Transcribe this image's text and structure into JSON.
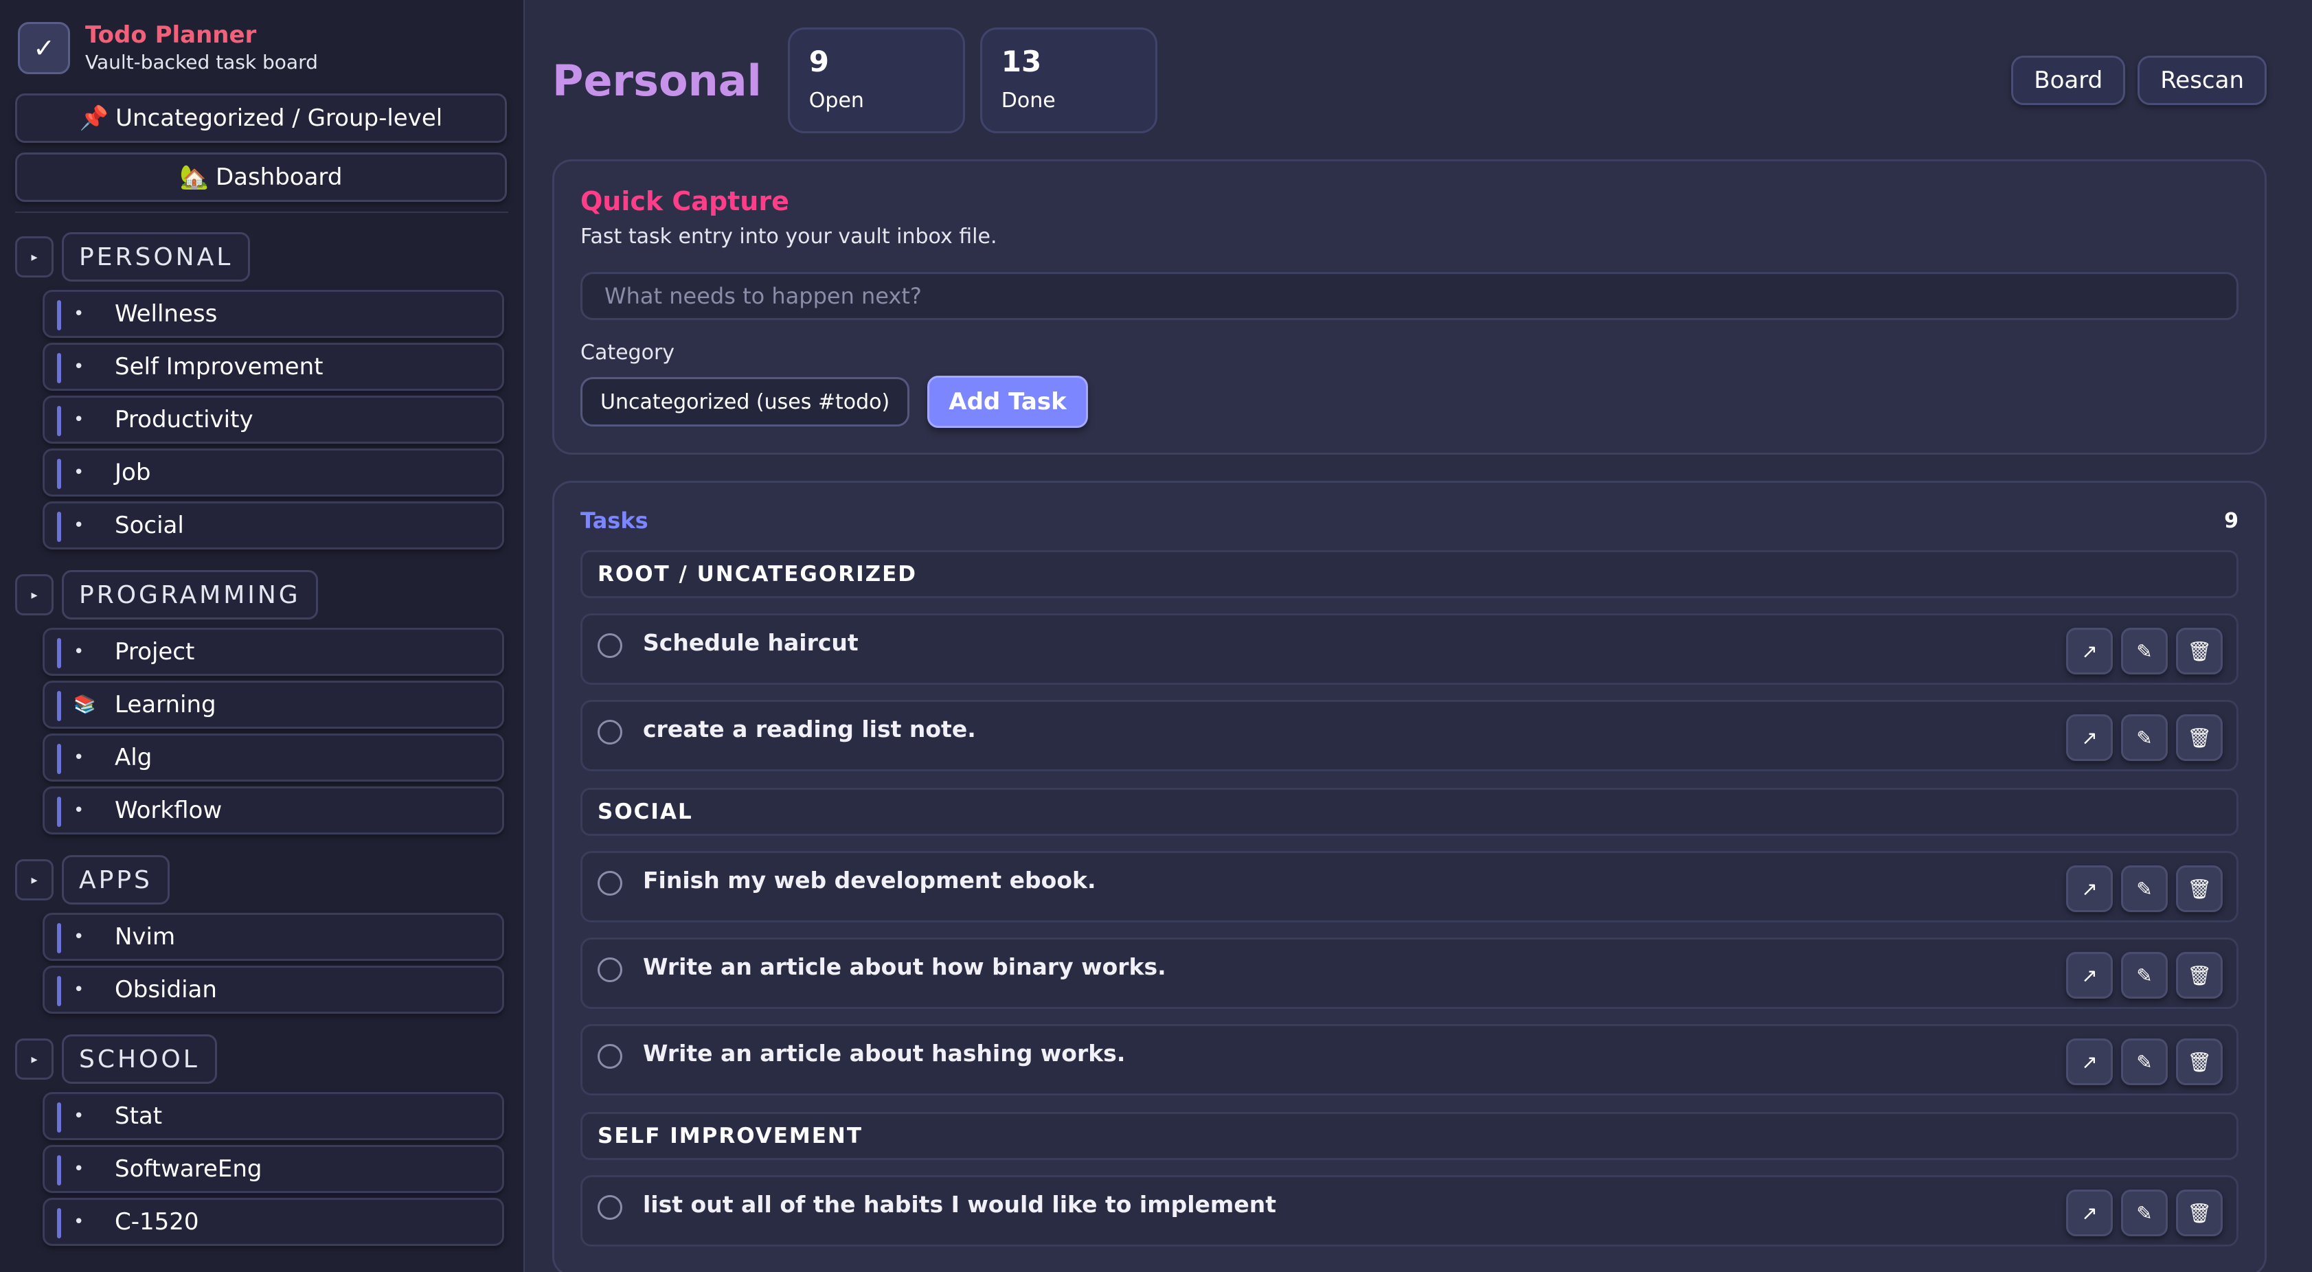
{
  "brand": {
    "title": "Todo Planner",
    "subtitle": "Vault-backed task board",
    "check_icon": "✓"
  },
  "sidebar": {
    "top_buttons": [
      {
        "icon": "📌",
        "label": "Uncategorized / Group-level"
      },
      {
        "icon": "🏡",
        "label": "Dashboard"
      }
    ],
    "groups": [
      {
        "label": "PERSONAL",
        "items": [
          {
            "icon": "•",
            "label": "Wellness"
          },
          {
            "icon": "•",
            "label": "Self Improvement"
          },
          {
            "icon": "•",
            "label": "Productivity"
          },
          {
            "icon": "•",
            "label": "Job"
          },
          {
            "icon": "•",
            "label": "Social"
          }
        ]
      },
      {
        "label": "PROGRAMMING",
        "items": [
          {
            "icon": "•",
            "label": "Project"
          },
          {
            "icon": "📚",
            "label": "Learning"
          },
          {
            "icon": "•",
            "label": "Alg"
          },
          {
            "icon": "•",
            "label": "Workflow"
          }
        ]
      },
      {
        "label": "APPS",
        "items": [
          {
            "icon": "•",
            "label": "Nvim"
          },
          {
            "icon": "•",
            "label": "Obsidian"
          }
        ]
      },
      {
        "label": "SCHOOL",
        "items": [
          {
            "icon": "•",
            "label": "Stat"
          },
          {
            "icon": "•",
            "label": "SoftwareEng"
          },
          {
            "icon": "•",
            "label": "C-1520"
          }
        ]
      }
    ]
  },
  "header": {
    "title": "Personal",
    "stats": {
      "open_value": "9",
      "open_label": "Open",
      "done_value": "13",
      "done_label": "Done"
    },
    "board_label": "Board",
    "rescan_label": "Rescan"
  },
  "quick_capture": {
    "title": "Quick Capture",
    "subtitle": "Fast task entry into your vault inbox file.",
    "input_placeholder": "What needs to happen next?",
    "input_value": "",
    "category_label": "Category",
    "category_selected": "Uncategorized (uses #todo)",
    "add_label": "Add Task"
  },
  "tasks": {
    "title": "Tasks",
    "count": "9",
    "sections": [
      {
        "name": "ROOT / UNCATEGORIZED",
        "tasks": [
          "Schedule haircut",
          "create a reading list note."
        ]
      },
      {
        "name": "SOCIAL",
        "tasks": [
          "Finish my web development ebook.",
          "Write an article about how binary works.",
          "Write an article about hashing works."
        ]
      },
      {
        "name": "SELF IMPROVEMENT",
        "tasks": [
          "list out all of the habits I would like to implement"
        ]
      }
    ],
    "action_icons": {
      "open": "↗",
      "edit": "✎",
      "delete": "🗑"
    }
  },
  "colors": {
    "accent": "#7c86ff",
    "title": "#c792ea",
    "quick_capture": "#ff3d88",
    "brand": "#f2607a"
  }
}
